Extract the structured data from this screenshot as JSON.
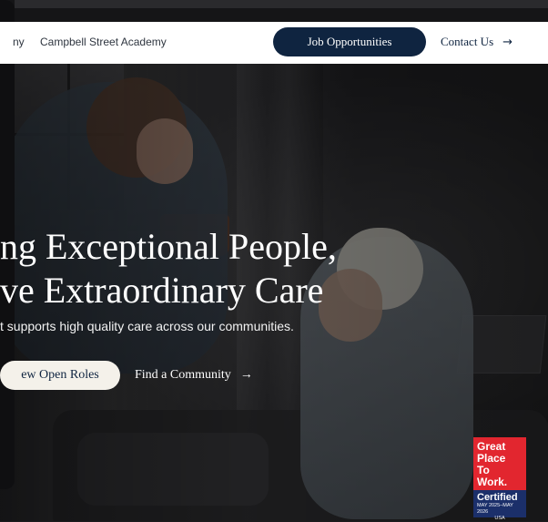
{
  "header": {
    "brand_trail": "ny",
    "academy_link": "Campbell Street Academy",
    "jobs_button": "Job Opportunities",
    "contact_link": "Contact Us",
    "contact_arrow": "→"
  },
  "hero": {
    "headline_line1": "ng Exceptional People,",
    "headline_line2": "ve Extraordinary Care",
    "subcopy": "t supports high quality care across our communities.",
    "cta_primary": "ew Open Roles",
    "cta_secondary": "Find a Community",
    "cta_secondary_arrow": "→"
  },
  "badge": {
    "line1": "Great",
    "line2": "Place",
    "line3": "To",
    "line4": "Work.",
    "certified": "Certified",
    "dates": "MAY 2025–MAY 2026",
    "country": "USA",
    "colors": {
      "red": "#e2262f",
      "blue": "#1b2f6a"
    }
  },
  "colors": {
    "navy": "#0f2440",
    "cream": "#f4f1ea",
    "white": "#ffffff"
  },
  "icons": {
    "arrow": "arrow-right-icon"
  }
}
